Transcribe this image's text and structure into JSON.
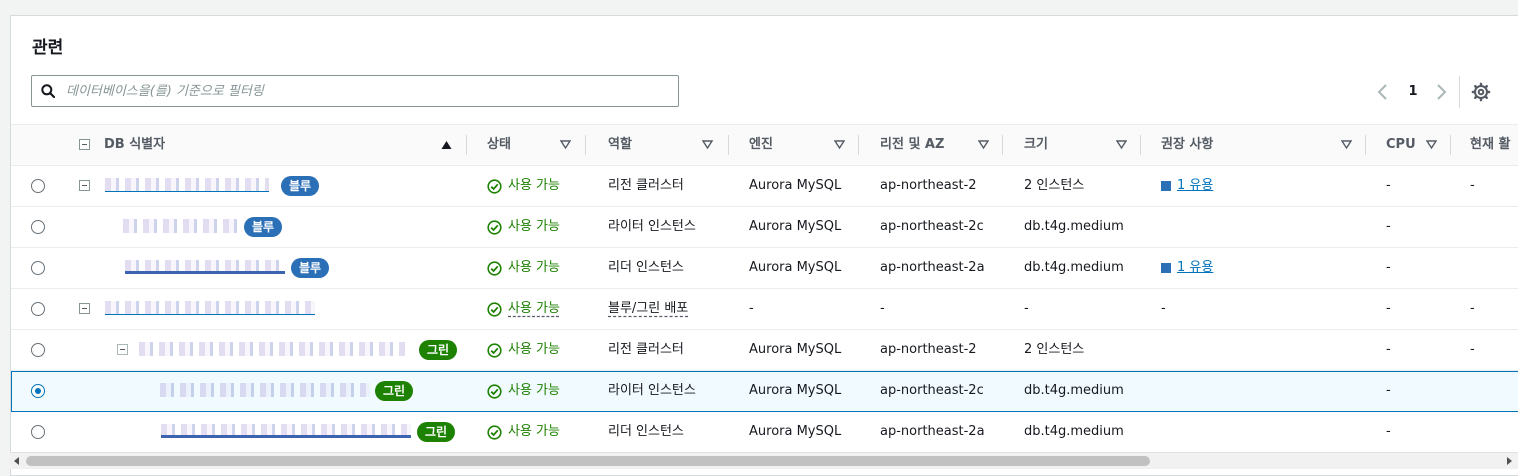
{
  "panel": {
    "title": "관련"
  },
  "search": {
    "placeholder": "데이터베이스을(를) 기준으로 필터링",
    "value": ""
  },
  "pagination": {
    "current_page": "1"
  },
  "columns": [
    {
      "label": "DB 식별자",
      "sort": "ascending"
    },
    {
      "label": "상태"
    },
    {
      "label": "역할"
    },
    {
      "label": "엔진"
    },
    {
      "label": "리전 및 AZ"
    },
    {
      "label": "크기"
    },
    {
      "label": "권장 사항"
    },
    {
      "label": "CPU"
    },
    {
      "label": "현재 활"
    }
  ],
  "rows": [
    {
      "badge": "블루",
      "badge_color": "#2b6fb6",
      "status": "사용 가능",
      "role": "리전 클러스터",
      "engine": "Aurora MySQL",
      "region": "ap-northeast-2",
      "size": "2 인스턴스",
      "recommendation": "1 유용",
      "cpu": "-",
      "activity": "-",
      "selected": false
    },
    {
      "badge": "블루",
      "badge_color": "#2b6fb6",
      "status": "사용 가능",
      "role": "라이터 인스턴스",
      "engine": "Aurora MySQL",
      "region": "ap-northeast-2c",
      "size": "db.t4g.medium",
      "recommendation": "",
      "cpu": "-",
      "activity": "",
      "selected": false
    },
    {
      "badge": "블루",
      "badge_color": "#2b6fb6",
      "status": "사용 가능",
      "role": "리더 인스턴스",
      "engine": "Aurora MySQL",
      "region": "ap-northeast-2a",
      "size": "db.t4g.medium",
      "recommendation": "1 유용",
      "cpu": "-",
      "activity": "",
      "selected": false
    },
    {
      "badge": "",
      "status": "사용 가능",
      "role": "블루/그린 배포",
      "engine": "-",
      "region": "-",
      "size": "-",
      "recommendation": "-",
      "cpu": "-",
      "activity": "-",
      "selected": false
    },
    {
      "badge": "그린",
      "badge_color": "#1d8102",
      "status": "사용 가능",
      "role": "리전 클러스터",
      "engine": "Aurora MySQL",
      "region": "ap-northeast-2",
      "size": "2 인스턴스",
      "recommendation": "",
      "cpu": "-",
      "activity": "-",
      "selected": false
    },
    {
      "badge": "그린",
      "badge_color": "#1d8102",
      "status": "사용 가능",
      "role": "라이터 인스턴스",
      "engine": "Aurora MySQL",
      "region": "ap-northeast-2c",
      "size": "db.t4g.medium",
      "recommendation": "",
      "cpu": "-",
      "activity": "",
      "selected": true
    },
    {
      "badge": "그린",
      "badge_color": "#1d8102",
      "status": "사용 가능",
      "role": "리더 인스턴스",
      "engine": "Aurora MySQL",
      "region": "ap-northeast-2a",
      "size": "db.t4g.medium",
      "recommendation": "",
      "cpu": "-",
      "activity": "",
      "selected": false
    }
  ],
  "colors": {
    "accent": "#0073bb",
    "status_ok": "#1d8102",
    "badge_blue": "#2b6fb6",
    "badge_green": "#1d8102"
  },
  "icons": {
    "search": "search-icon",
    "settings": "gear-icon",
    "status": "check-circle-icon",
    "prev": "chevron-left-icon",
    "next": "chevron-right-icon"
  }
}
